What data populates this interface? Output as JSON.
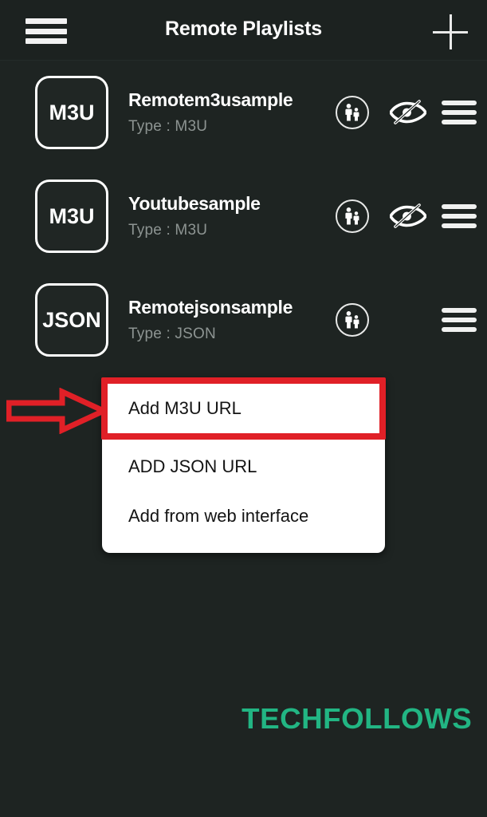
{
  "appbar": {
    "title": "Remote Playlists",
    "menu_icon": "hamburger-icon",
    "add_icon": "plus-icon"
  },
  "playlists": [
    {
      "badge": "M3U",
      "title": "Remotem3usample",
      "subtitle": "Type : M3U",
      "has_parental_icon": true,
      "has_hidden_icon": true,
      "has_menu_icon": true
    },
    {
      "badge": "M3U",
      "title": "Youtubesample",
      "subtitle": "Type : M3U",
      "has_parental_icon": true,
      "has_hidden_icon": true,
      "has_menu_icon": true
    },
    {
      "badge": "JSON",
      "title": "Remotejsonsample",
      "subtitle": "Type : JSON",
      "has_parental_icon": true,
      "has_hidden_icon": false,
      "has_menu_icon": true
    }
  ],
  "popup_menu": {
    "items": [
      {
        "label": "Add M3U URL",
        "highlighted": true
      },
      {
        "label": "ADD JSON URL",
        "highlighted": false
      },
      {
        "label": "Add from web interface",
        "highlighted": false
      }
    ]
  },
  "annotation": {
    "arrow": "right-arrow",
    "color": "#e02027"
  },
  "watermark": {
    "text": "TECHFOLLOWS",
    "color": "#22b583"
  },
  "colors": {
    "background": "#1e2422",
    "appbar": "#1c2220",
    "title_text": "#ffffff",
    "subtitle_text": "#8d9492",
    "menu_background": "#ffffff",
    "menu_text": "#141414",
    "highlight": "#e02027"
  }
}
